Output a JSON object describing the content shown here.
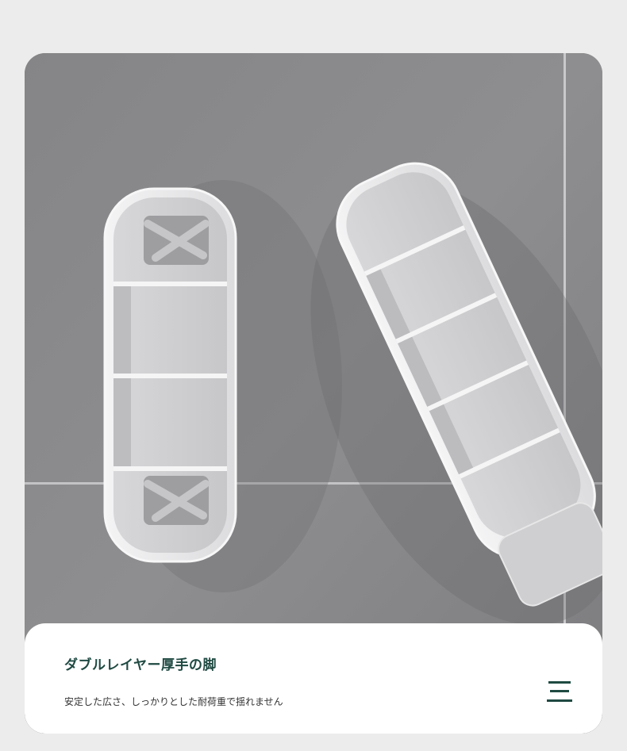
{
  "caption": {
    "title": "ダブルレイヤー厚手の脚",
    "subtitle": "安定した広さ、しっかりとした耐荷重で揺れません"
  },
  "icons": {
    "menu": "menu-icon"
  },
  "colors": {
    "page_background": "#ececec",
    "photo_background": "#8a8a8c",
    "caption_background": "#ffffff",
    "title_text": "#1f4a42",
    "icon": "#1f4a42"
  }
}
